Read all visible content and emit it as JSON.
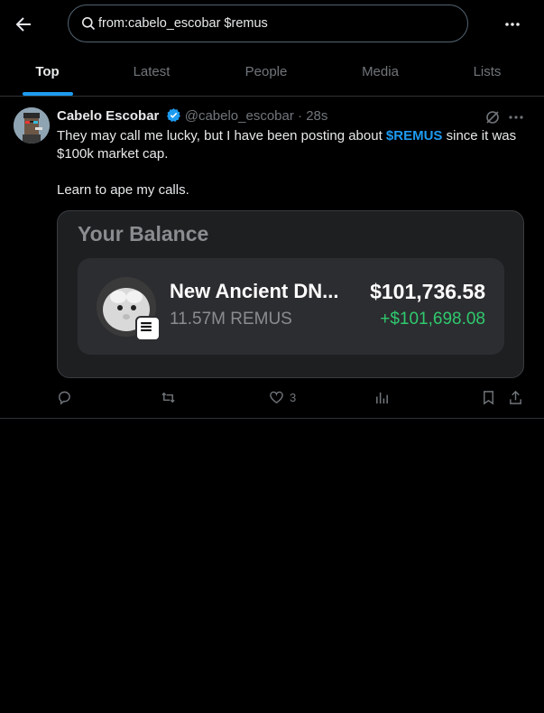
{
  "search": {
    "value": "from:cabelo_escobar $remus"
  },
  "tabs": [
    {
      "label": "Top",
      "active": true
    },
    {
      "label": "Latest"
    },
    {
      "label": "People"
    },
    {
      "label": "Media"
    },
    {
      "label": "Lists"
    }
  ],
  "post": {
    "author_name": "Cabelo Escobar",
    "handle": "@cabelo_escobar",
    "separator": "·",
    "time": "28s",
    "text_line1_before": "They may call me lucky, but I have been posting about ",
    "cashtag": "$REMUS",
    "text_line1_after": " since it was $100k market cap.",
    "text_line2": "Learn to ape my calls.",
    "card": {
      "title": "Your Balance",
      "token_name": "New Ancient DN...",
      "token_amount": "11.57M REMUS",
      "value": "$101,736.58",
      "gain": "+$101,698.08"
    },
    "actions": {
      "likes": "3"
    }
  },
  "colors": {
    "accent": "#1d9bf0",
    "gain": "#2fc96e",
    "background": "#000000"
  }
}
